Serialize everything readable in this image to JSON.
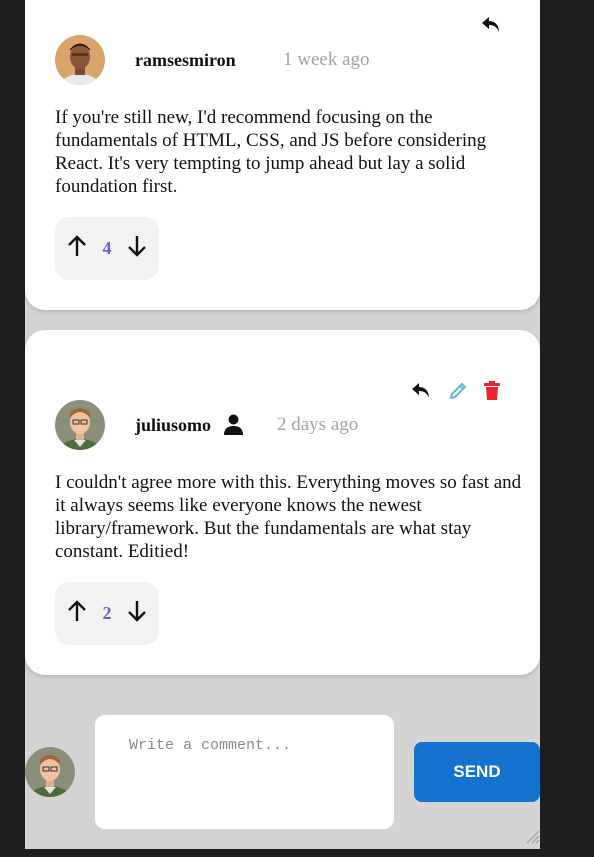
{
  "comments": [
    {
      "username": "ramsesmiron",
      "time": "1 week ago",
      "text": "If you're still new, I'd recommend focusing on the fundamentals of HTML, CSS, and JS before considering React. It's very tempting to jump ahead but lay a solid foundation first.",
      "score": "4",
      "is_current_user": false,
      "actions": [
        "reply-icon"
      ]
    },
    {
      "username": "juliusomo",
      "time": "2 days ago",
      "text": "I couldn't agree more with this. Everything moves so fast and it always seems like everyone knows the newest library/framework. But the fundamentals are what stay constant. Editied!",
      "score": "2",
      "is_current_user": true,
      "actions": [
        "reply-icon",
        "edit-icon",
        "delete-icon"
      ]
    }
  ],
  "composer": {
    "placeholder": "Write a comment...",
    "send_label": "SEND"
  },
  "colors": {
    "vote_count": "#6b5fd0",
    "send_button": "#1572cf",
    "edit_icon": "#5fb8d4",
    "delete_icon": "#e8242c",
    "page_background": "#d4d4d4"
  }
}
